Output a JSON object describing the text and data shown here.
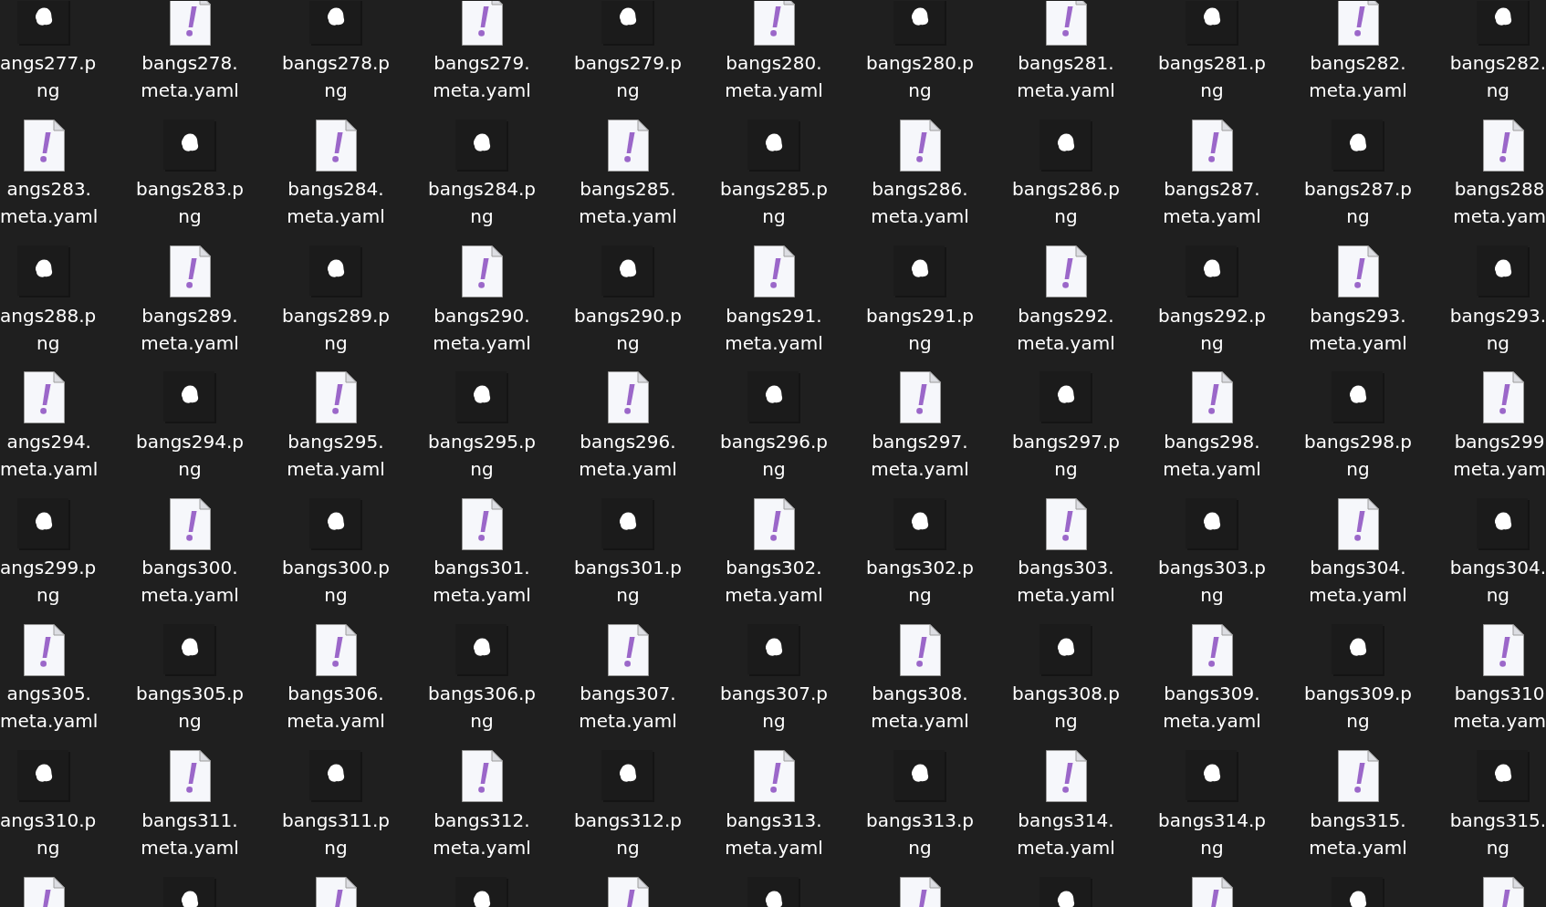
{
  "file_grid": {
    "rows": [
      {
        "files": [
          {
            "kind": "png",
            "label_lines": [
              "angs277.p",
              "ng"
            ]
          },
          {
            "kind": "yaml",
            "label_lines": [
              "bangs278.",
              "meta.yaml"
            ]
          },
          {
            "kind": "png",
            "label_lines": [
              "bangs278.p",
              "ng"
            ]
          },
          {
            "kind": "yaml",
            "label_lines": [
              "bangs279.",
              "meta.yaml"
            ]
          },
          {
            "kind": "png",
            "label_lines": [
              "bangs279.p",
              "ng"
            ]
          },
          {
            "kind": "yaml",
            "label_lines": [
              "bangs280.",
              "meta.yaml"
            ]
          },
          {
            "kind": "png",
            "label_lines": [
              "bangs280.p",
              "ng"
            ]
          },
          {
            "kind": "yaml",
            "label_lines": [
              "bangs281.",
              "meta.yaml"
            ]
          },
          {
            "kind": "png",
            "label_lines": [
              "bangs281.p",
              "ng"
            ]
          },
          {
            "kind": "yaml",
            "label_lines": [
              "bangs282.",
              "meta.yaml"
            ]
          },
          {
            "kind": "png",
            "label_lines": [
              "bangs282.",
              "ng"
            ]
          }
        ]
      },
      {
        "files": [
          {
            "kind": "yaml",
            "label_lines": [
              "angs283.",
              "meta.yaml"
            ]
          },
          {
            "kind": "png",
            "label_lines": [
              "bangs283.p",
              "ng"
            ]
          },
          {
            "kind": "yaml",
            "label_lines": [
              "bangs284.",
              "meta.yaml"
            ]
          },
          {
            "kind": "png",
            "label_lines": [
              "bangs284.p",
              "ng"
            ]
          },
          {
            "kind": "yaml",
            "label_lines": [
              "bangs285.",
              "meta.yaml"
            ]
          },
          {
            "kind": "png",
            "label_lines": [
              "bangs285.p",
              "ng"
            ]
          },
          {
            "kind": "yaml",
            "label_lines": [
              "bangs286.",
              "meta.yaml"
            ]
          },
          {
            "kind": "png",
            "label_lines": [
              "bangs286.p",
              "ng"
            ]
          },
          {
            "kind": "yaml",
            "label_lines": [
              "bangs287.",
              "meta.yaml"
            ]
          },
          {
            "kind": "png",
            "label_lines": [
              "bangs287.p",
              "ng"
            ]
          },
          {
            "kind": "yaml",
            "label_lines": [
              "bangs288",
              "meta.yam"
            ]
          }
        ]
      },
      {
        "files": [
          {
            "kind": "png",
            "label_lines": [
              "angs288.p",
              "ng"
            ]
          },
          {
            "kind": "yaml",
            "label_lines": [
              "bangs289.",
              "meta.yaml"
            ]
          },
          {
            "kind": "png",
            "label_lines": [
              "bangs289.p",
              "ng"
            ]
          },
          {
            "kind": "yaml",
            "label_lines": [
              "bangs290.",
              "meta.yaml"
            ]
          },
          {
            "kind": "png",
            "label_lines": [
              "bangs290.p",
              "ng"
            ]
          },
          {
            "kind": "yaml",
            "label_lines": [
              "bangs291.",
              "meta.yaml"
            ]
          },
          {
            "kind": "png",
            "label_lines": [
              "bangs291.p",
              "ng"
            ]
          },
          {
            "kind": "yaml",
            "label_lines": [
              "bangs292.",
              "meta.yaml"
            ]
          },
          {
            "kind": "png",
            "label_lines": [
              "bangs292.p",
              "ng"
            ]
          },
          {
            "kind": "yaml",
            "label_lines": [
              "bangs293.",
              "meta.yaml"
            ]
          },
          {
            "kind": "png",
            "label_lines": [
              "bangs293.",
              "ng"
            ]
          }
        ]
      },
      {
        "files": [
          {
            "kind": "yaml",
            "label_lines": [
              "angs294.",
              "meta.yaml"
            ]
          },
          {
            "kind": "png",
            "label_lines": [
              "bangs294.p",
              "ng"
            ]
          },
          {
            "kind": "yaml",
            "label_lines": [
              "bangs295.",
              "meta.yaml"
            ]
          },
          {
            "kind": "png",
            "label_lines": [
              "bangs295.p",
              "ng"
            ]
          },
          {
            "kind": "yaml",
            "label_lines": [
              "bangs296.",
              "meta.yaml"
            ]
          },
          {
            "kind": "png",
            "label_lines": [
              "bangs296.p",
              "ng"
            ]
          },
          {
            "kind": "yaml",
            "label_lines": [
              "bangs297.",
              "meta.yaml"
            ]
          },
          {
            "kind": "png",
            "label_lines": [
              "bangs297.p",
              "ng"
            ]
          },
          {
            "kind": "yaml",
            "label_lines": [
              "bangs298.",
              "meta.yaml"
            ]
          },
          {
            "kind": "png",
            "label_lines": [
              "bangs298.p",
              "ng"
            ]
          },
          {
            "kind": "yaml",
            "label_lines": [
              "bangs299",
              "meta.yam"
            ]
          }
        ]
      },
      {
        "files": [
          {
            "kind": "png",
            "label_lines": [
              "angs299.p",
              "ng"
            ]
          },
          {
            "kind": "yaml",
            "label_lines": [
              "bangs300.",
              "meta.yaml"
            ]
          },
          {
            "kind": "png",
            "label_lines": [
              "bangs300.p",
              "ng"
            ]
          },
          {
            "kind": "yaml",
            "label_lines": [
              "bangs301.",
              "meta.yaml"
            ]
          },
          {
            "kind": "png",
            "label_lines": [
              "bangs301.p",
              "ng"
            ]
          },
          {
            "kind": "yaml",
            "label_lines": [
              "bangs302.",
              "meta.yaml"
            ]
          },
          {
            "kind": "png",
            "label_lines": [
              "bangs302.p",
              "ng"
            ]
          },
          {
            "kind": "yaml",
            "label_lines": [
              "bangs303.",
              "meta.yaml"
            ]
          },
          {
            "kind": "png",
            "label_lines": [
              "bangs303.p",
              "ng"
            ]
          },
          {
            "kind": "yaml",
            "label_lines": [
              "bangs304.",
              "meta.yaml"
            ]
          },
          {
            "kind": "png",
            "label_lines": [
              "bangs304.",
              "ng"
            ]
          }
        ]
      },
      {
        "files": [
          {
            "kind": "yaml",
            "label_lines": [
              "angs305.",
              "meta.yaml"
            ]
          },
          {
            "kind": "png",
            "label_lines": [
              "bangs305.p",
              "ng"
            ]
          },
          {
            "kind": "yaml",
            "label_lines": [
              "bangs306.",
              "meta.yaml"
            ]
          },
          {
            "kind": "png",
            "label_lines": [
              "bangs306.p",
              "ng"
            ]
          },
          {
            "kind": "yaml",
            "label_lines": [
              "bangs307.",
              "meta.yaml"
            ]
          },
          {
            "kind": "png",
            "label_lines": [
              "bangs307.p",
              "ng"
            ]
          },
          {
            "kind": "yaml",
            "label_lines": [
              "bangs308.",
              "meta.yaml"
            ]
          },
          {
            "kind": "png",
            "label_lines": [
              "bangs308.p",
              "ng"
            ]
          },
          {
            "kind": "yaml",
            "label_lines": [
              "bangs309.",
              "meta.yaml"
            ]
          },
          {
            "kind": "png",
            "label_lines": [
              "bangs309.p",
              "ng"
            ]
          },
          {
            "kind": "yaml",
            "label_lines": [
              "bangs310",
              "meta.yam"
            ]
          }
        ]
      },
      {
        "files": [
          {
            "kind": "png",
            "label_lines": [
              "angs310.p",
              "ng"
            ]
          },
          {
            "kind": "yaml",
            "label_lines": [
              "bangs311.",
              "meta.yaml"
            ]
          },
          {
            "kind": "png",
            "label_lines": [
              "bangs311.p",
              "ng"
            ]
          },
          {
            "kind": "yaml",
            "label_lines": [
              "bangs312.",
              "meta.yaml"
            ]
          },
          {
            "kind": "png",
            "label_lines": [
              "bangs312.p",
              "ng"
            ]
          },
          {
            "kind": "yaml",
            "label_lines": [
              "bangs313.",
              "meta.yaml"
            ]
          },
          {
            "kind": "png",
            "label_lines": [
              "bangs313.p",
              "ng"
            ]
          },
          {
            "kind": "yaml",
            "label_lines": [
              "bangs314.",
              "meta.yaml"
            ]
          },
          {
            "kind": "png",
            "label_lines": [
              "bangs314.p",
              "ng"
            ]
          },
          {
            "kind": "yaml",
            "label_lines": [
              "bangs315.",
              "meta.yaml"
            ]
          },
          {
            "kind": "png",
            "label_lines": [
              "bangs315.",
              "ng"
            ]
          }
        ]
      },
      {
        "files": [
          {
            "kind": "yaml"
          },
          {
            "kind": "png"
          },
          {
            "kind": "yaml"
          },
          {
            "kind": "png"
          },
          {
            "kind": "yaml"
          },
          {
            "kind": "png"
          },
          {
            "kind": "yaml"
          },
          {
            "kind": "png"
          },
          {
            "kind": "yaml"
          },
          {
            "kind": "png"
          },
          {
            "kind": "yaml"
          }
        ]
      }
    ]
  }
}
